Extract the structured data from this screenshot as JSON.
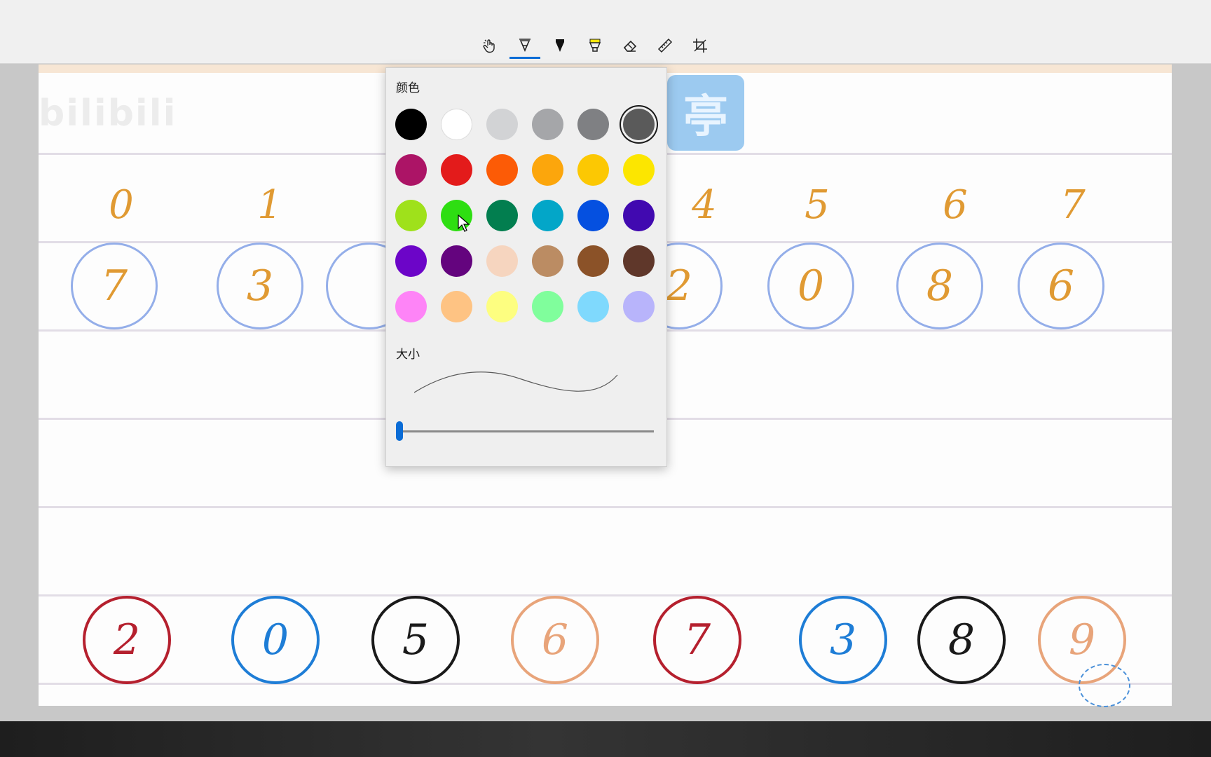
{
  "toolbar": {
    "tools": [
      {
        "name": "touch-writing-icon",
        "active": false
      },
      {
        "name": "ballpoint-pen-icon",
        "active": true
      },
      {
        "name": "pencil-icon",
        "active": false
      },
      {
        "name": "highlighter-icon",
        "active": false
      },
      {
        "name": "eraser-icon",
        "active": false
      },
      {
        "name": "ruler-icon",
        "active": false
      },
      {
        "name": "crop-icon",
        "active": false
      }
    ],
    "accent": "#0a6cd6"
  },
  "canvas": {
    "watermark": "bilibili",
    "badge_char": "亭",
    "index_labels": [
      "0",
      "1",
      "4",
      "5",
      "6",
      "7"
    ],
    "top_circles": [
      "7",
      "3",
      "2",
      "0",
      "8",
      "6"
    ],
    "bottom_circles": [
      {
        "digit": "2",
        "color": "#b5202e"
      },
      {
        "digit": "0",
        "color": "#1e7dd6"
      },
      {
        "digit": "5",
        "color": "#1a1a1a"
      },
      {
        "digit": "6",
        "color": "#e8a47a"
      },
      {
        "digit": "7",
        "color": "#b5202e"
      },
      {
        "digit": "3",
        "color": "#1e7dd6"
      },
      {
        "digit": "8",
        "color": "#1a1a1a"
      },
      {
        "digit": "9",
        "color": "#e8a47a"
      }
    ]
  },
  "flyout": {
    "color_label": "颜色",
    "size_label": "大小",
    "selected_color": "#5a5a5a",
    "colors": [
      "#000000",
      "#ffffff",
      "#d2d3d5",
      "#a5a6a9",
      "#7f8083",
      "#5a5a5a",
      "#ac1466",
      "#e31b1b",
      "#fc5b06",
      "#fca60c",
      "#fcc803",
      "#fce600",
      "#9fe11b",
      "#2ede12",
      "#027e4f",
      "#03a6c8",
      "#0550e0",
      "#4109b0",
      "#6c05c8",
      "#64047e",
      "#f6d5bf",
      "#bb8c63",
      "#8b5228",
      "#5f372a",
      "#fe84f7",
      "#fec383",
      "#fdfe80",
      "#80fe9c",
      "#7fd9fd",
      "#b8b4fb"
    ],
    "size_value": 0
  }
}
